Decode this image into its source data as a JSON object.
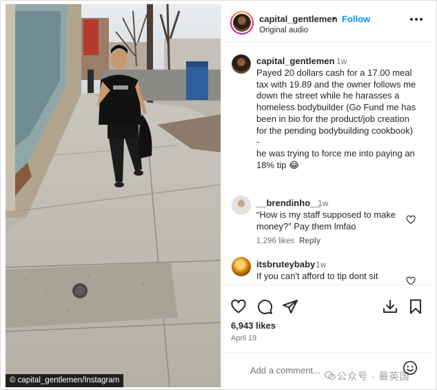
{
  "image_credit": "© capital_gentlemen/Instagram",
  "header": {
    "username": "capital_gentlemen",
    "separator": "•",
    "follow_label": "Follow",
    "subtitle": "Original audio",
    "more_icon": "more-horizontal-icon"
  },
  "caption": {
    "username": "capital_gentlemen",
    "time": "1w",
    "text": "Payed 20 dollars cash for a 17.00 meal tax with 19.89 and the owner follows me down the street while he harasses a homeless bodybuilder (Go Fund me has been in bio for the product/job creation for the pending bodybuilding cookbook)\n-\nhe was trying to force me into paying an 18% tip 😂"
  },
  "comments": [
    {
      "username": "__brendinho__",
      "time": "1w",
      "text": "“How is my staff supposed to make money?” Pay them lmfao",
      "likes": "1,296 likes",
      "reply_label": "Reply"
    },
    {
      "username": "itsbruteybaby",
      "time": "1w",
      "text": "If you can't afford to tip dont sit"
    }
  ],
  "actions": {
    "icons": [
      "heart-icon",
      "comment-icon",
      "share-icon",
      "download-icon",
      "bookmark-icon"
    ],
    "likes": "6,943 likes",
    "date": "April 19"
  },
  "add_comment": {
    "placeholder": "Add a comment...",
    "watermark": "公众号 · 最英国"
  },
  "colors": {
    "accent": "#0095f6",
    "text": "#262626",
    "muted": "#737373"
  }
}
